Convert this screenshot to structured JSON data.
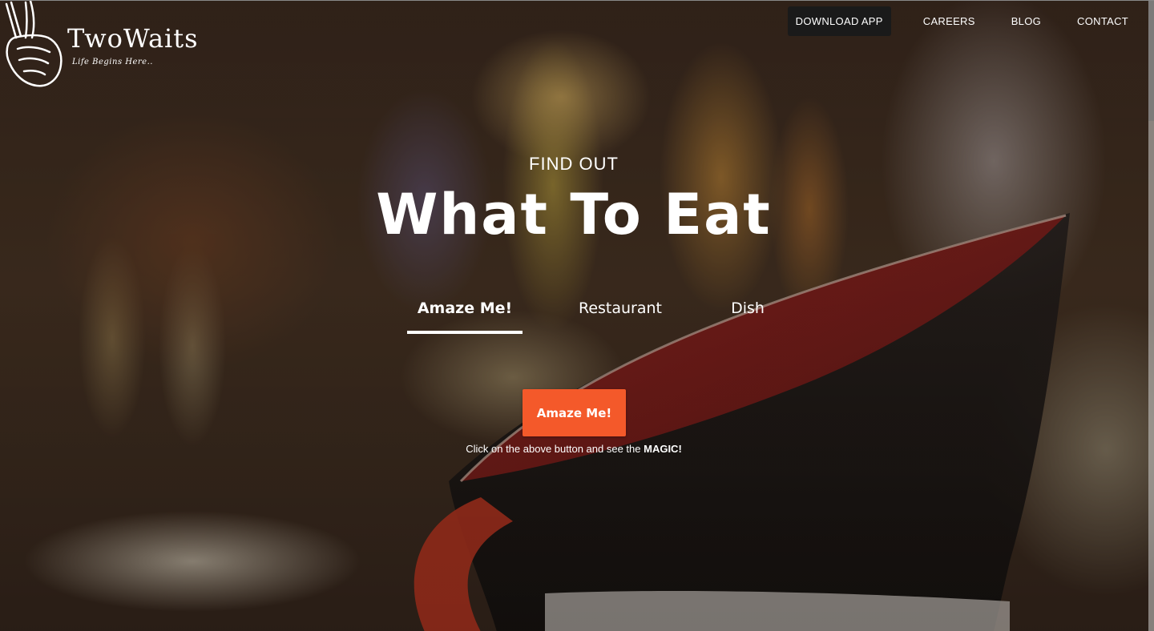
{
  "brand": {
    "name": "TwoWaits",
    "tagline": "Life Begins Here.."
  },
  "nav": {
    "download": "DOWNLOAD APP",
    "careers": "CAREERS",
    "blog": "BLOG",
    "contact": "CONTACT"
  },
  "hero": {
    "kicker": "FIND OUT",
    "title": "What To Eat"
  },
  "tabs": [
    {
      "label": "Amaze Me!",
      "active": true
    },
    {
      "label": "Restaurant",
      "active": false
    },
    {
      "label": "Dish",
      "active": false
    }
  ],
  "cta": {
    "button": "Amaze Me!",
    "hint_prefix": "Click on the above button and see the ",
    "hint_emphasis": "MAGIC!"
  },
  "colors": {
    "accent": "#f4592a",
    "download_bg": "#1a1a1a"
  }
}
